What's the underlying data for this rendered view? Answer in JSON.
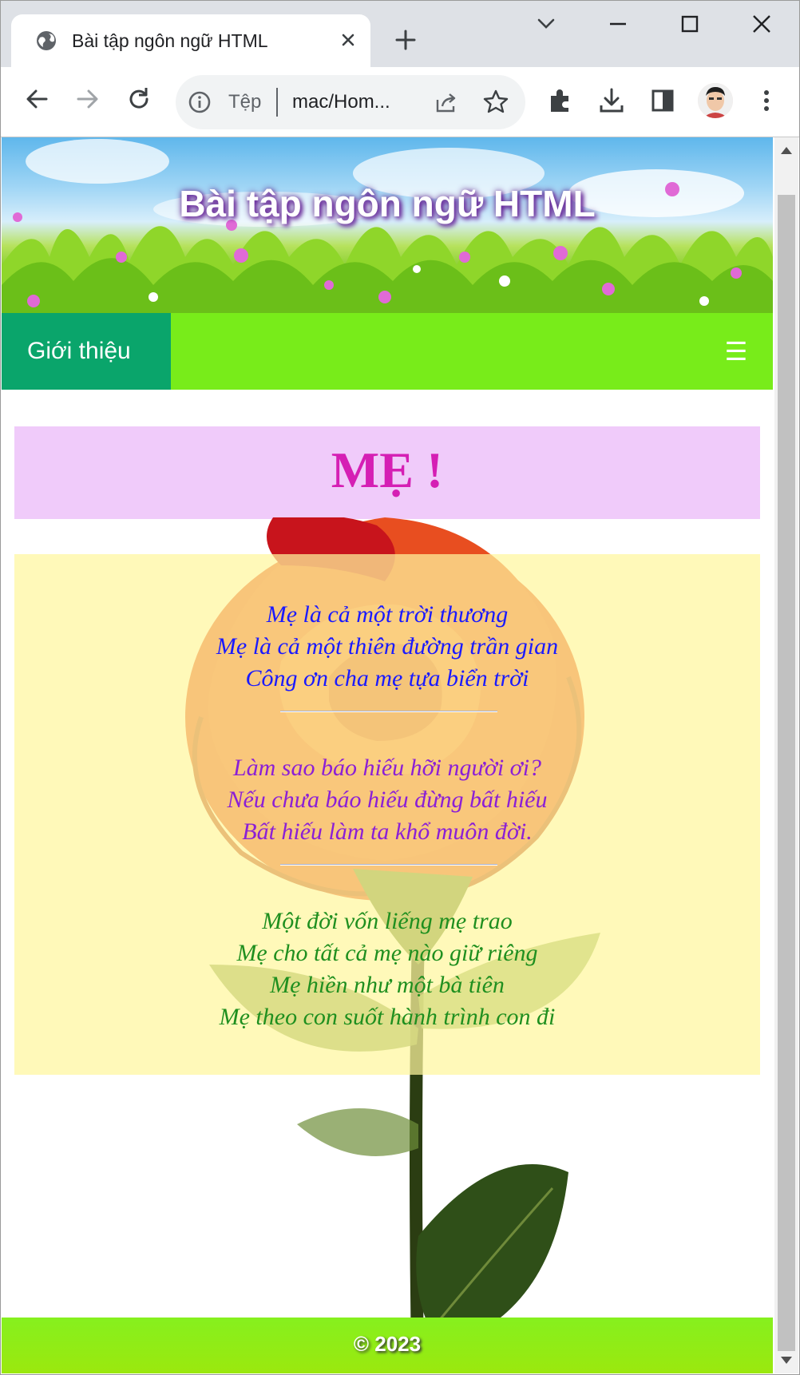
{
  "browser": {
    "tab_title": "Bài tập ngôn ngữ HTML",
    "address_scheme": "Tệp",
    "address_url": "mac/Hom..."
  },
  "page": {
    "banner_title": "Bài tập ngôn ngữ HTML",
    "nav": {
      "items": [
        {
          "label": "Giới thiệu"
        }
      ],
      "toggle_glyph": "☰"
    },
    "heading": "MẸ !",
    "poem": {
      "stanzas": [
        {
          "color": "#1a1aff",
          "lines": [
            "Mẹ là cả một trời thương",
            "Mẹ là cả một thiên đường trần gian",
            "Công ơn cha mẹ tựa biển trời"
          ]
        },
        {
          "color": "#8b1fd6",
          "lines": [
            "Làm sao báo hiếu hỡi người ơi?",
            "Nếu chưa báo hiếu đừng bất hiếu",
            "Bất hiếu làm ta khổ muôn đời."
          ]
        },
        {
          "color": "#1f8f1f",
          "lines": [
            "Một đời vốn liếng mẹ trao",
            "Mẹ cho tất cả mẹ nào giữ riêng",
            "Mẹ hiền như một bà tiên",
            "Mẹ theo con suốt hành trình con đi"
          ]
        }
      ]
    },
    "footer": "© 2023"
  },
  "colors": {
    "nav_bar": "#78ec1a",
    "nav_active": "#0aa56b",
    "heading_bg": "#f0cbfa",
    "heading_text": "#d51fb4",
    "poem_bg": "#fff69e"
  },
  "icons": [
    "globe-icon",
    "close-icon",
    "plus-icon",
    "chevron-down-icon",
    "minimize-icon",
    "maximize-icon",
    "back-icon",
    "forward-icon",
    "reload-icon",
    "info-icon",
    "share-icon",
    "star-icon",
    "extensions-icon",
    "download-icon",
    "side-panel-icon",
    "more-icon",
    "menu-icon"
  ]
}
